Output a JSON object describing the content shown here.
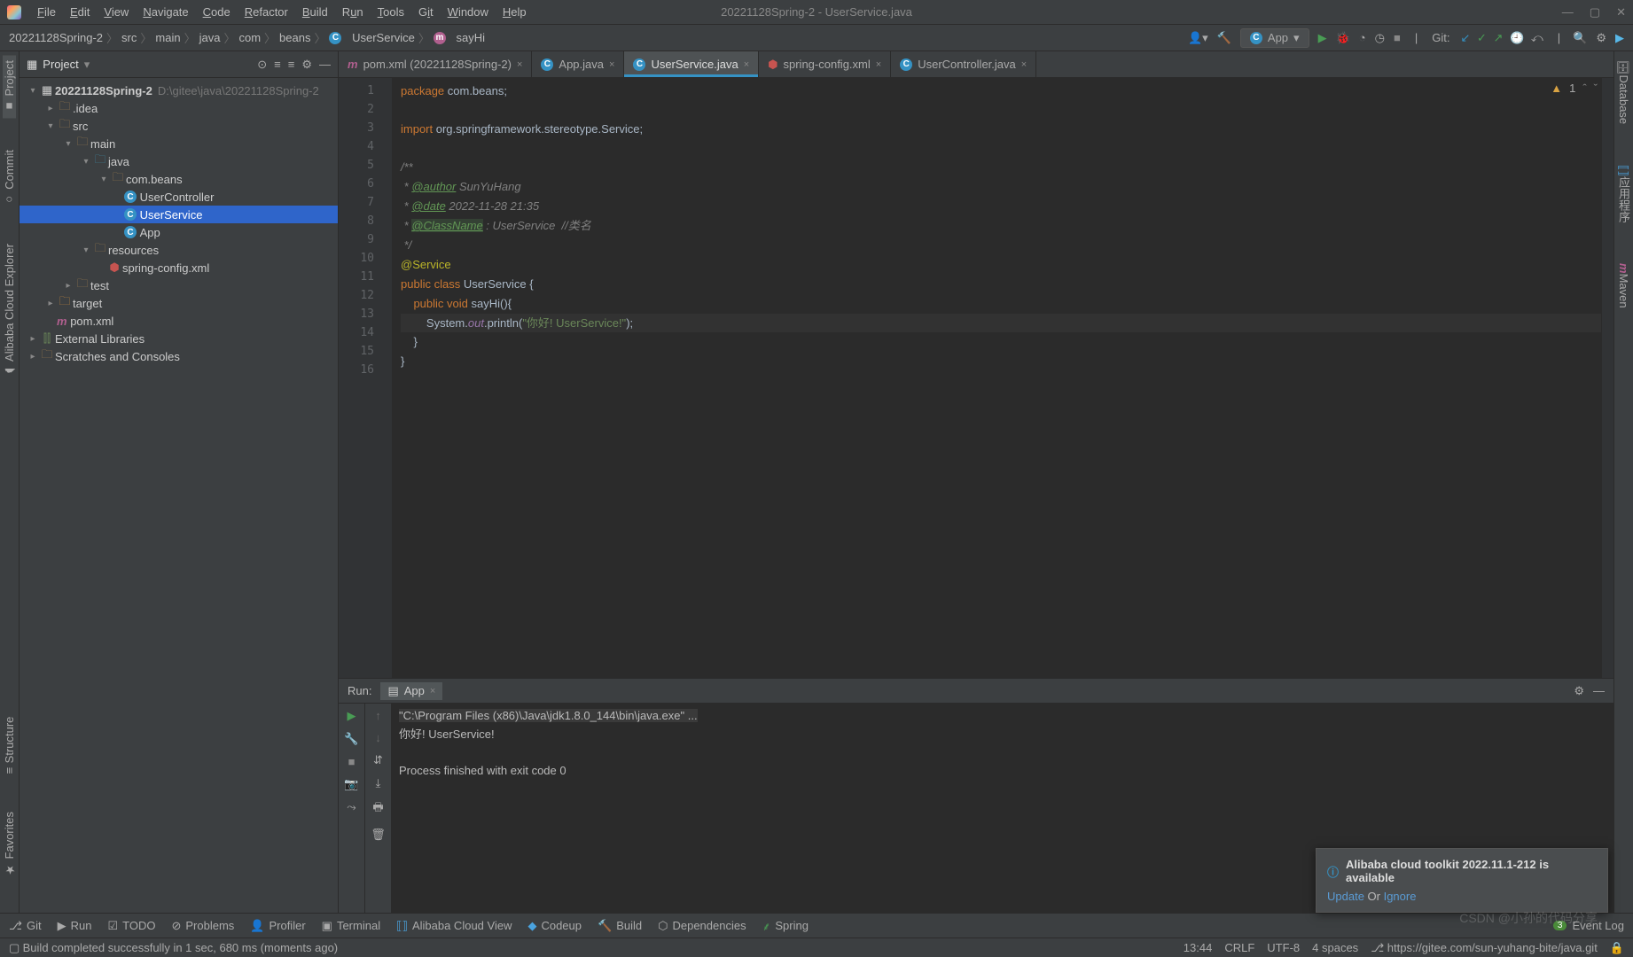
{
  "window": {
    "title": "20221128Spring-2 - UserService.java"
  },
  "menu": [
    "File",
    "Edit",
    "View",
    "Navigate",
    "Code",
    "Refactor",
    "Build",
    "Run",
    "Tools",
    "Git",
    "Window",
    "Help"
  ],
  "breadcrumb": [
    "20221128Spring-2",
    "src",
    "main",
    "java",
    "com",
    "beans",
    "UserService",
    "sayHi"
  ],
  "runConfig": {
    "label": "App"
  },
  "gitLabel": "Git:",
  "leftStripe": [
    "Project",
    "Commit",
    "Alibaba Cloud Explorer",
    "Structure",
    "Favorites"
  ],
  "rightStripe": [
    "Database",
    "应用程序",
    "Maven"
  ],
  "projectPanel": {
    "title": "Project",
    "tree": {
      "root": {
        "name": "20221128Spring-2",
        "path": "D:\\gitee\\java\\20221128Spring-2"
      },
      "idea": ".idea",
      "src": "src",
      "main": "main",
      "java": "java",
      "pkg": "com.beans",
      "userController": "UserController",
      "userService": "UserService",
      "app": "App",
      "resources": "resources",
      "springConfig": "spring-config.xml",
      "test": "test",
      "target": "target",
      "pom": "pom.xml",
      "extLib": "External Libraries",
      "scratches": "Scratches and Consoles"
    }
  },
  "editorTabs": [
    {
      "label": "pom.xml (20221128Spring-2)",
      "icon": "m"
    },
    {
      "label": "App.java",
      "icon": "c"
    },
    {
      "label": "UserService.java",
      "icon": "c",
      "active": true
    },
    {
      "label": "spring-config.xml",
      "icon": "xml"
    },
    {
      "label": "UserController.java",
      "icon": "c"
    }
  ],
  "inspection": {
    "warnings": "1"
  },
  "code": {
    "lines": [
      "1",
      "2",
      "3",
      "4",
      "5",
      "6",
      "7",
      "8",
      "9",
      "10",
      "11",
      "12",
      "13",
      "14",
      "15",
      "16"
    ],
    "l1_kw": "package ",
    "l1_pkg": "com.beans",
    "l1_semi": ";",
    "l3_kw": "import ",
    "l3_pkg": "org.springframework.stereotype.",
    "l3_cls": "Service",
    "l3_semi": ";",
    "l5": "/**",
    "l6_star": " * ",
    "l6_tag": "@author",
    "l6_txt": " SunYuHang",
    "l7_star": " * ",
    "l7_tag": "@date",
    "l7_txt": " 2022-11-28 21:35",
    "l8_star": " * ",
    "l8_tag": "@ClassName",
    "l8_txt": " : UserService  //类名",
    "l9": " */",
    "l10": "@Service",
    "l11_kw1": "public ",
    "l11_kw2": "class ",
    "l11_cls": "UserService ",
    "l11_br": "{",
    "l12_ind": "    ",
    "l12_kw1": "public ",
    "l12_kw2": "void ",
    "l12_m": "sayHi()",
    "l12_br": "{",
    "l13_ind": "        ",
    "l13_a": "System.",
    "l13_out": "out",
    "l13_b": ".println(",
    "l13_str": "\"你好! UserService!\"",
    "l13_c": ");",
    "l14": "    }",
    "l15": "}"
  },
  "runPanel": {
    "label": "Run:",
    "tabName": "App",
    "console": {
      "cmd": "\"C:\\Program Files (x86)\\Java\\jdk1.8.0_144\\bin\\java.exe\" ...",
      "out1": "你好! UserService!",
      "out2": "Process finished with exit code 0"
    }
  },
  "bottomBar": {
    "git": "Git",
    "run": "Run",
    "todo": "TODO",
    "problems": "Problems",
    "profiler": "Profiler",
    "terminal": "Terminal",
    "aliCloud": "Alibaba Cloud View",
    "codeup": "Codeup",
    "build": "Build",
    "deps": "Dependencies",
    "spring": "Spring",
    "eventCount": "3",
    "eventLog": "Event Log"
  },
  "statusBar": {
    "msg": "Build completed successfully in 1 sec, 680 ms (moments ago)",
    "time": "13:44",
    "eol": "CRLF",
    "enc": "UTF-8",
    "indent": "4 spaces",
    "branch": "https://gitee.com/sun-yuhang-bite/java.git"
  },
  "notification": {
    "title": "Alibaba cloud toolkit 2022.11.1-212 is available",
    "update": "Update",
    "or": " Or ",
    "ignore": "Ignore"
  },
  "watermark": "CSDN @小孙的代码分享"
}
